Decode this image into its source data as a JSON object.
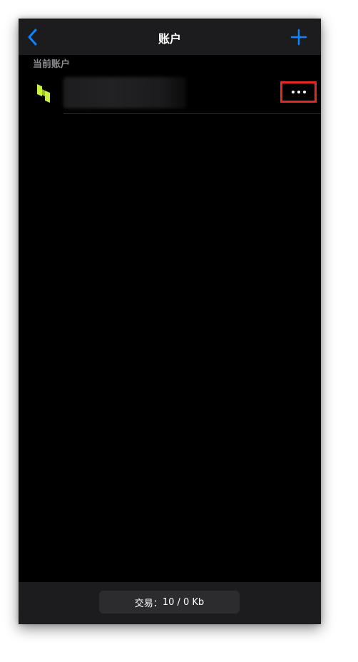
{
  "navbar": {
    "title": "账户",
    "back_icon": "chevron-left-icon",
    "add_icon": "plus-icon",
    "accent_color": "#0a84ff"
  },
  "section": {
    "header": "当前账户"
  },
  "account": {
    "name_blurred": true,
    "logo_icon": "broker-logo-icon",
    "logo_color": "#c8f03c",
    "more_icon": "ellipsis-icon",
    "highlight_color": "#e32626"
  },
  "footer": {
    "traffic_label": "交易：",
    "traffic_value": "10 / 0 Kb"
  }
}
